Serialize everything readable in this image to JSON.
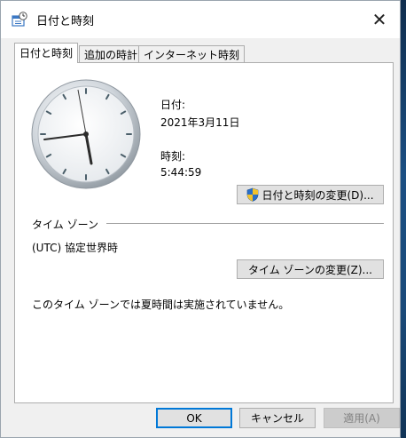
{
  "window": {
    "title": "日付と時刻",
    "close_label": "✕"
  },
  "tabs": [
    {
      "label": "日付と時刻",
      "active": true
    },
    {
      "label": "追加の時計",
      "active": false
    },
    {
      "label": "インターネット時刻",
      "active": false
    }
  ],
  "datetime": {
    "date_label": "日付:",
    "date_value": "2021年3月11日",
    "time_label": "時刻:",
    "time_value": "5:44:59",
    "change_button": "日付と時刻の変更(D)..."
  },
  "timezone": {
    "group_label": "タイム ゾーン",
    "value": "(UTC) 協定世界時",
    "change_button": "タイム ゾーンの変更(Z)...",
    "dst_note": "このタイム ゾーンでは夏時間は実施されていません。"
  },
  "footer": {
    "ok": "OK",
    "cancel": "キャンセル",
    "apply": "適用(A)"
  },
  "colors": {
    "accent": "#0078d7",
    "shield_blue": "#2a6fc9",
    "shield_yellow": "#f3c22b"
  },
  "icons": {
    "title": "date-time-icon",
    "close": "close-icon",
    "shield": "uac-shield-icon"
  }
}
